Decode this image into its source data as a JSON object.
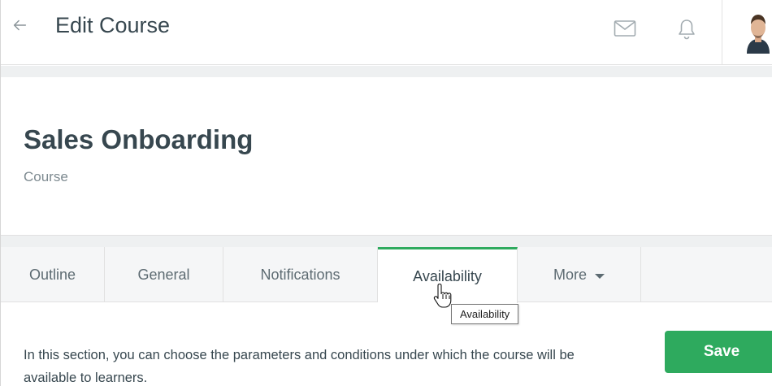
{
  "header": {
    "title": "Edit Course",
    "icons": {
      "back": "arrow-left-icon",
      "mail": "mail-icon",
      "notifications": "bell-icon"
    }
  },
  "course": {
    "title": "Sales Onboarding",
    "type": "Course"
  },
  "tabs": [
    {
      "label": "Outline",
      "active": false
    },
    {
      "label": "General",
      "active": false
    },
    {
      "label": "Notifications",
      "active": false
    },
    {
      "label": "Availability",
      "active": true
    },
    {
      "label": "More",
      "active": false,
      "has_dropdown": true
    }
  ],
  "tooltip": {
    "text": "Availability"
  },
  "content": {
    "description": "In this section, you can choose the parameters and conditions under which the course will be available to learners.",
    "save_label": "Save"
  },
  "colors": {
    "accent": "#2eaa5e",
    "text": "#37474f",
    "muted": "#7d8a90",
    "band": "#eef0f1"
  }
}
